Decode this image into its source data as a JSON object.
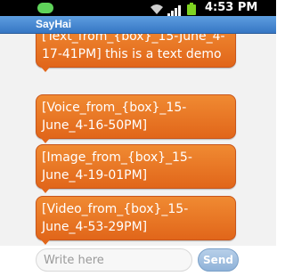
{
  "status_bar": {
    "time": "4:53 PM",
    "icons": [
      "notification-icon",
      "wifi-icon",
      "signal-icon",
      "battery-icon"
    ]
  },
  "app": {
    "title": "SayHai"
  },
  "messages": [
    {
      "text": "[Text_from_{box}_15-June_4-17-41PM] this is a text demo"
    },
    {
      "text": "[Voice_from_{box}_15-June_4-16-50PM]"
    },
    {
      "text": "[Image_from_{box}_15-June_4-19-01PM]"
    },
    {
      "text": "[Video_from_{box}_15-June_4-53-29PM]"
    }
  ],
  "composer": {
    "placeholder": "Write here",
    "value": "",
    "send_label": "Send"
  },
  "colors": {
    "bubble": "#e8721f",
    "titlebar": "#4a8ad6",
    "send_button": "#9dbde0"
  }
}
